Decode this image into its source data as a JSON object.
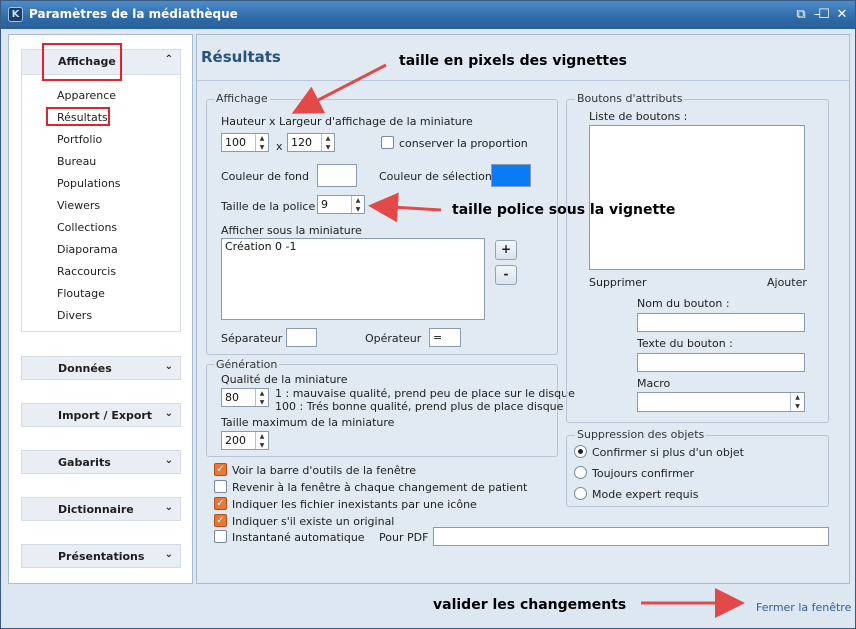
{
  "window": {
    "title": "Paramètres de la médiathèque",
    "logo": "K"
  },
  "titlebar_icons": [
    "restore-icon",
    "minimize-icon",
    "maximize-icon",
    "close-icon"
  ],
  "titlebar_glyphs": {
    "restore": "⧉",
    "minimize": "–",
    "maximize": "☐",
    "close": "✕"
  },
  "sidebar": {
    "expanded_group": {
      "label": "Affichage",
      "chevron": "⌃"
    },
    "items": [
      "Apparence",
      "Résultats",
      "Portfolio",
      "Bureau",
      "Populations",
      "Viewers",
      "Collections",
      "Diaporama",
      "Raccourcis",
      "Floutage",
      "Divers"
    ],
    "groups": [
      {
        "label": "Données",
        "chevron": "⌄"
      },
      {
        "label": "Import / Export",
        "chevron": "⌄"
      },
      {
        "label": "Gabarits",
        "chevron": "⌄"
      },
      {
        "label": "Dictionnaire",
        "chevron": "⌄"
      },
      {
        "label": "Présentations",
        "chevron": "⌄"
      }
    ]
  },
  "main": {
    "title": "Résultats",
    "affichage": {
      "legend": "Affichage",
      "size_label": "Hauteur x Largeur d'affichage de la miniature",
      "height": "100",
      "times": "x",
      "width": "120",
      "keep_ratio_label": "conserver la proportion",
      "bg_color_label": "Couleur de fond",
      "bg_color": "#ffffff",
      "sel_color_label": "Couleur de sélection",
      "sel_color": "#0a7af5",
      "font_size_label": "Taille de la police",
      "font_size": "9",
      "show_under_label": "Afficher sous la miniature",
      "show_under_value": "Création 0 -1",
      "plus": "+",
      "minus": "-",
      "separator_label": "Séparateur",
      "separator_value": "",
      "operator_label": "Opérateur",
      "operator_value": "="
    },
    "generation": {
      "legend": "Génération",
      "quality_label": "Qualité de la miniature",
      "quality": "80",
      "quality_help_1": "1 : mauvaise qualité, prend peu de place sur le disque",
      "quality_help_2": "100 : Trés bonne qualité, prend plus de place disque",
      "max_size_label": "Taille maximum de la miniature",
      "max_size": "200"
    },
    "options": [
      {
        "label": "Voir la barre d'outils de la fenêtre",
        "checked": true
      },
      {
        "label": "Revenir à la fenêtre à chaque changement de patient",
        "checked": false
      },
      {
        "label": "Indiquer les fichier inexistants par une icône",
        "checked": true
      },
      {
        "label": "Indiquer s'il existe un original",
        "checked": true
      },
      {
        "label": "Instantané automatique",
        "checked": false
      }
    ],
    "check_glyph": "✓",
    "pdf_label": "Pour PDF",
    "pdf_value": "",
    "attributes": {
      "legend": "Boutons d'attributs",
      "list_label": "Liste de boutons :",
      "delete": "Supprimer",
      "add": "Ajouter",
      "name_label": "Nom du bouton :",
      "text_label": "Texte du bouton :",
      "macro_label": "Macro",
      "macro_value": ""
    },
    "deletion": {
      "legend": "Suppression des objets",
      "options": [
        "Confirmer si plus d'un objet",
        "Toujours confirmer",
        "Mode expert requis"
      ],
      "selected_index": 0
    }
  },
  "footer": {
    "close": "Fermer la fenêtre"
  },
  "annotations": {
    "thumb_size": "taille en pixels des vignettes",
    "font_under": "taille police sous la vignette",
    "validate": "valider les changements"
  },
  "colors": {
    "annotation_arrow": "#e24a4a",
    "highlight_box": "#e0232e",
    "title": "#29527f"
  }
}
